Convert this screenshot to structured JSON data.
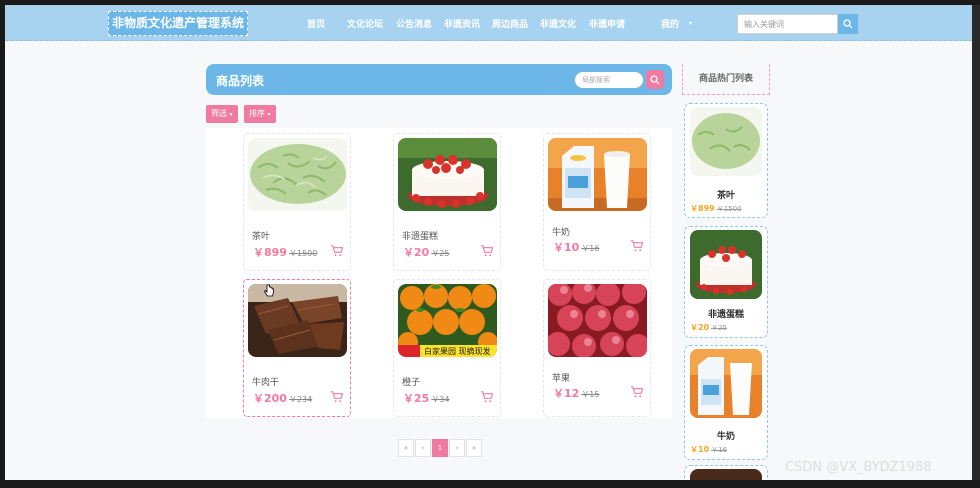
{
  "header": {
    "logo": "非物质文化遗产管理系统",
    "nav": [
      "首页",
      "文化论坛",
      "公告消息",
      "非遗资讯",
      "周边商品",
      "非遗文化",
      "非遗申请"
    ],
    "user_menu": "我的",
    "search_placeholder": "输入关键词"
  },
  "main": {
    "title": "商品列表",
    "search_placeholder": "局部搜索",
    "filter_label": "筛选",
    "sort_label": "排序",
    "products": [
      {
        "name": "茶叶",
        "price": "￥899",
        "old_price": "￥1500",
        "image": "tea"
      },
      {
        "name": "非遗蛋糕",
        "price": "￥20",
        "old_price": "￥25",
        "image": "cake"
      },
      {
        "name": "牛奶",
        "price": "￥10",
        "old_price": "￥16",
        "image": "milk"
      },
      {
        "name": "牛肉干",
        "price": "￥200",
        "old_price": "￥234",
        "image": "beef"
      },
      {
        "name": "橙子",
        "price": "￥25",
        "old_price": "￥34",
        "image": "orange"
      },
      {
        "name": "苹果",
        "price": "￥12",
        "old_price": "￥15",
        "image": "apple"
      }
    ],
    "pagination": [
      "«",
      "‹",
      "1",
      "›",
      "»"
    ],
    "current_page": "1",
    "orange_banner_text": "白家果园 现摘现发"
  },
  "sidebar": {
    "title": "商品热门列表",
    "items": [
      {
        "name": "茶叶",
        "price": "￥899",
        "old_price": "￥1500"
      },
      {
        "name": "非遗蛋糕",
        "price": "￥20",
        "old_price": "￥25"
      },
      {
        "name": "牛奶",
        "price": "￥10",
        "old_price": "￥16"
      }
    ]
  },
  "watermark": "CSDN @VX_BYDZ1988",
  "colors": {
    "primary": "#6cb7e8",
    "accent": "#f07aa0",
    "topbar": "#a7d3f0",
    "price_side": "#f5a623"
  }
}
